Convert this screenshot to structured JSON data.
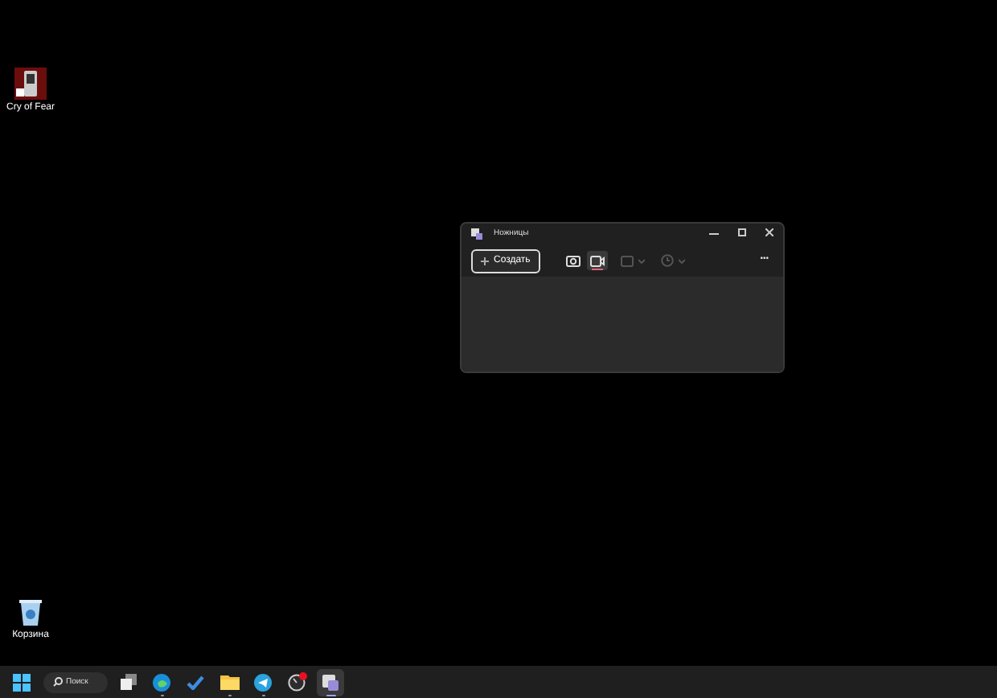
{
  "desktop_icons": [
    {
      "kind": "game",
      "label": "Cry of Fear"
    },
    {
      "kind": "bin",
      "label": "Корзина"
    }
  ],
  "window": {
    "title": "Ножницы",
    "new_button": "Создать",
    "more": "•••",
    "modes": [
      {
        "kind": "camera",
        "selected": false
      },
      {
        "kind": "video",
        "selected": true
      }
    ],
    "options": [
      {
        "kind": "shape",
        "disabled": true
      },
      {
        "kind": "timer",
        "disabled": true
      }
    ]
  },
  "taskbar": {
    "search": {
      "placeholder": "Поиск"
    },
    "apps": [
      {
        "kind": "taskview",
        "running": false,
        "active": false
      },
      {
        "kind": "browser",
        "running": true,
        "active": false
      },
      {
        "kind": "check",
        "running": false,
        "active": false
      },
      {
        "kind": "folder",
        "running": true,
        "active": false
      },
      {
        "kind": "telegram",
        "running": true,
        "active": false
      },
      {
        "kind": "badge",
        "running": false,
        "active": false
      },
      {
        "kind": "snip",
        "running": true,
        "active": true
      }
    ]
  }
}
